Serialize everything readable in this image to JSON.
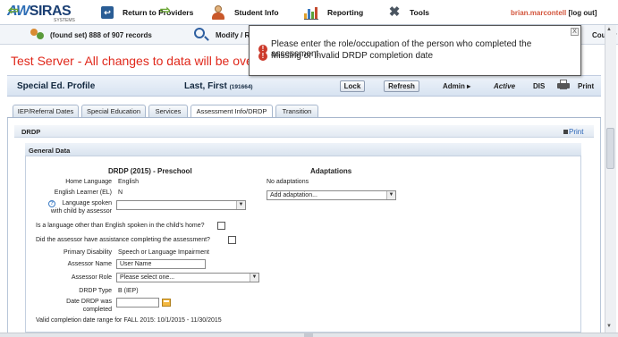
{
  "brand": {
    "name_part1": "AW",
    "name_part2": "SIRAS",
    "tagline": "SYSTEMS"
  },
  "topnav": {
    "return_label": "Return to Providers",
    "student_info_label": "Student Info",
    "reporting_label": "Reporting",
    "tools_label": "Tools",
    "user_name": "brian.marcontell",
    "logout_label": "[log out]"
  },
  "recordbar": {
    "record_status": "(found set) 888 of 907 records",
    "modify_label": "Modify / R",
    "county_label": "County"
  },
  "warning_banner": "Test Server - All changes to data will be overwrit",
  "errors": [
    "Please enter the role/occupation of the person who completed the assessment",
    "Missing or invalid DRDP completion date"
  ],
  "errors_close": "X",
  "profile": {
    "title": "Special Ed. Profile",
    "student_name": "Last, First",
    "student_id": "(191664)",
    "lock_label": "Lock",
    "refresh_label": "Refresh",
    "admin_label": "Admin ▸",
    "status": "Active",
    "dis_label": "DIS",
    "print_label": "Print"
  },
  "tabs": [
    {
      "label": "IEP/Referral Dates"
    },
    {
      "label": "Special Education"
    },
    {
      "label": "Services"
    },
    {
      "label": "Assessment Info/DRDP"
    },
    {
      "label": "Transition"
    }
  ],
  "active_tab": "Assessment Info/DRDP",
  "drdp_section": {
    "title": "DRDP",
    "print_label": "Print"
  },
  "general": {
    "title": "General Data",
    "heading": "DRDP (2015) - Preschool",
    "home_language_label": "Home Language",
    "home_language_value": "English",
    "el_label": "English Learner (EL)",
    "el_value": "N",
    "lang_spoken_label_1": "Language spoken",
    "lang_spoken_label_2": "with child by assessor",
    "lang_spoken_value": "",
    "q_other_language": "Is a language other than English spoken in the child's home?",
    "q_assistance": "Did the assessor have assistance completing the assessment?",
    "primary_disability_label": "Primary Disability",
    "primary_disability_value": "Speech or Language Impairment",
    "assessor_name_label": "Assessor Name",
    "assessor_name_value": "User Name",
    "assessor_role_label": "Assessor Role",
    "assessor_role_value": "Please select one...",
    "drdp_type_label": "DRDP Type",
    "drdp_type_value": "B (IEP)",
    "date_label_1": "Date DRDP was",
    "date_label_2": "completed",
    "date_value": "",
    "valid_range": "Valid completion date range for FALL 2015: 10/1/2015 - 11/30/2015"
  },
  "adaptations": {
    "heading": "Adaptations",
    "status": "No adaptations",
    "add_placeholder": "Add adaptation..."
  },
  "colors": {
    "warning_red": "#e0281b",
    "brand_blue": "#1b3f73",
    "user_orange": "#d3553c",
    "link_blue": "#2561b5",
    "error_red": "#cc3b2c"
  }
}
